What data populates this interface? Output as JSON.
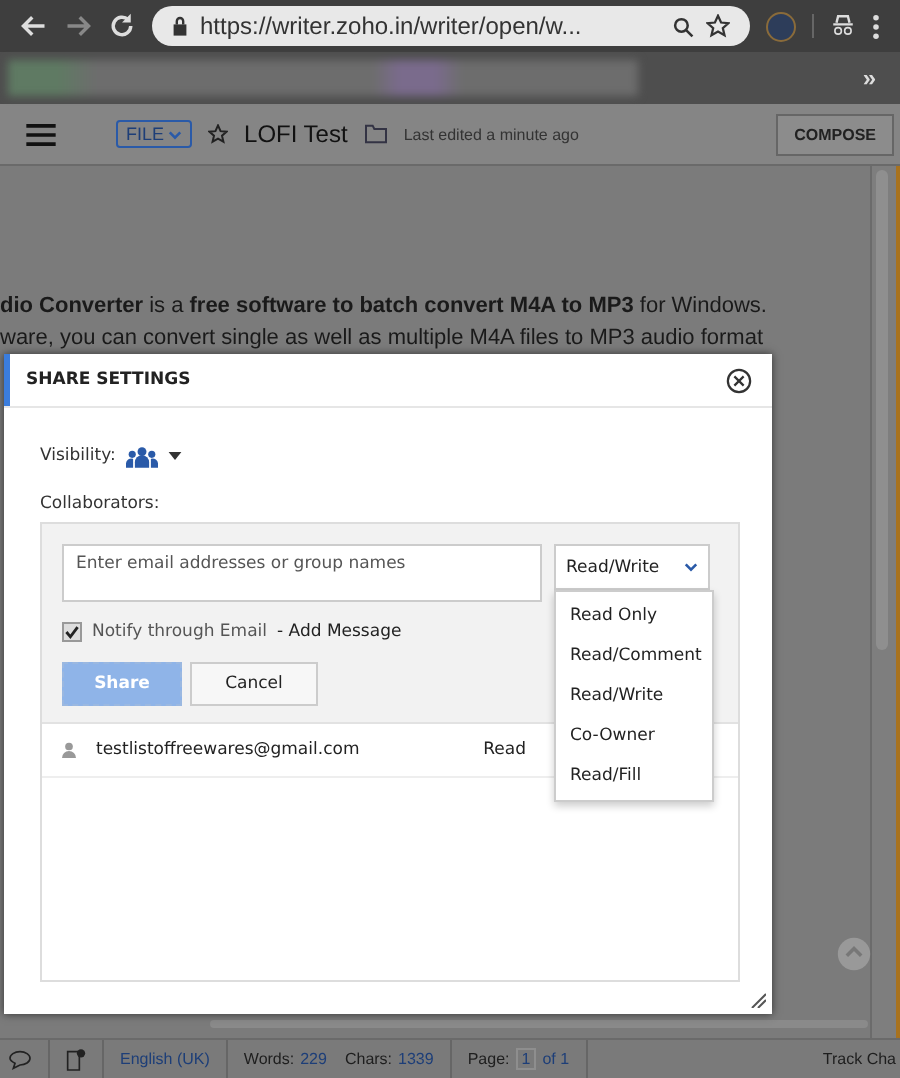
{
  "browser": {
    "url": "https://writer.zoho.in/writer/open/w...",
    "bookmarks_overflow": "»"
  },
  "header": {
    "file_menu": "FILE",
    "doc_title": "LOFI Test",
    "last_edited": "Last edited a minute ago",
    "compose": "COMPOSE"
  },
  "document": {
    "lines": [
      "**dio Converter** is a **free software to batch convert M4A to MP3** for Windows.",
      "ware, you can convert single as well as multiple M4A files to MP3 audio format"
    ]
  },
  "dialog": {
    "title": "SHARE SETTINGS",
    "visibility_label": "Visibility:",
    "collaborators_label": "Collaborators:",
    "email_field": {
      "placeholder": "Enter email addresses or group names"
    },
    "permission_select": {
      "value": "Read/Write",
      "expanded": true
    },
    "permission_options": [
      "Read Only",
      "Read/Comment",
      "Read/Write",
      "Co-Owner",
      "Read/Fill"
    ],
    "notify": {
      "label": "Notify through Email",
      "link": "- Add Message",
      "checked": true
    },
    "share_button": {
      "label": "Share",
      "disabled": true
    },
    "cancel_button": "Cancel",
    "collaborators": [
      {
        "email": "testlistoffreewares@gmail.com",
        "permission": "Read"
      }
    ]
  },
  "status_bar": {
    "language": "English (UK)",
    "words_label": "Words:",
    "words": "229",
    "chars_label": "Chars:",
    "chars": "1339",
    "page_label": "Page:",
    "page": "1",
    "page_total": "of 1",
    "track_changes": "Track Cha"
  }
}
